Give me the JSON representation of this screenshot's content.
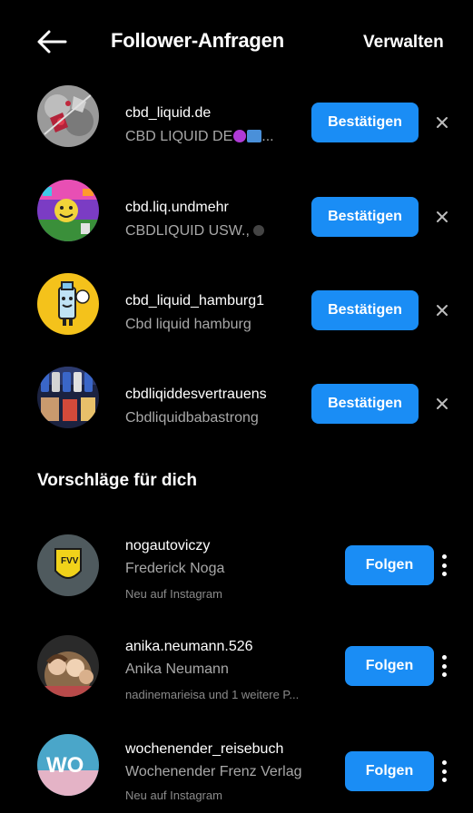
{
  "header": {
    "back_icon": "arrow-left-icon",
    "title": "Follower-Anfragen",
    "manage_label": "Verwalten"
  },
  "requests": [
    {
      "username": "cbd_liquid.de",
      "fullname": "CBD LIQUID DE",
      "fullname_suffix": "...",
      "confirm_label": "Bestätigen"
    },
    {
      "username": "cbd.liq.undmehr",
      "fullname": "CBDLIQUID USW.,",
      "confirm_label": "Bestätigen"
    },
    {
      "username": "cbd_liquid_hamburg1",
      "fullname": "Cbd liquid hamburg",
      "confirm_label": "Bestätigen"
    },
    {
      "username": "cbdliqiddesvertrauens",
      "fullname": "Cbdliquidbabastrong",
      "confirm_label": "Bestätigen"
    }
  ],
  "suggestions_title": "Vorschläge für dich",
  "suggestions": [
    {
      "username": "nogautoviczy",
      "fullname": "Frederick Noga",
      "meta": "Neu auf Instagram",
      "follow_label": "Folgen"
    },
    {
      "username": "anika.neumann.526",
      "fullname": "Anika Neumann",
      "meta": "nadinemarieisa und 1 weitere P...",
      "follow_label": "Folgen"
    },
    {
      "username": "wochenender_reisebuch",
      "fullname": "Wochenender Frenz Verlag",
      "meta": "Neu auf Instagram",
      "follow_label": "Folgen"
    }
  ],
  "avatar_logo_text": {
    "fvv": "FVV",
    "wo": "WO"
  },
  "colors": {
    "accent": "#1a8df5",
    "background": "#000000",
    "secondary_text": "#a8a8a8"
  }
}
